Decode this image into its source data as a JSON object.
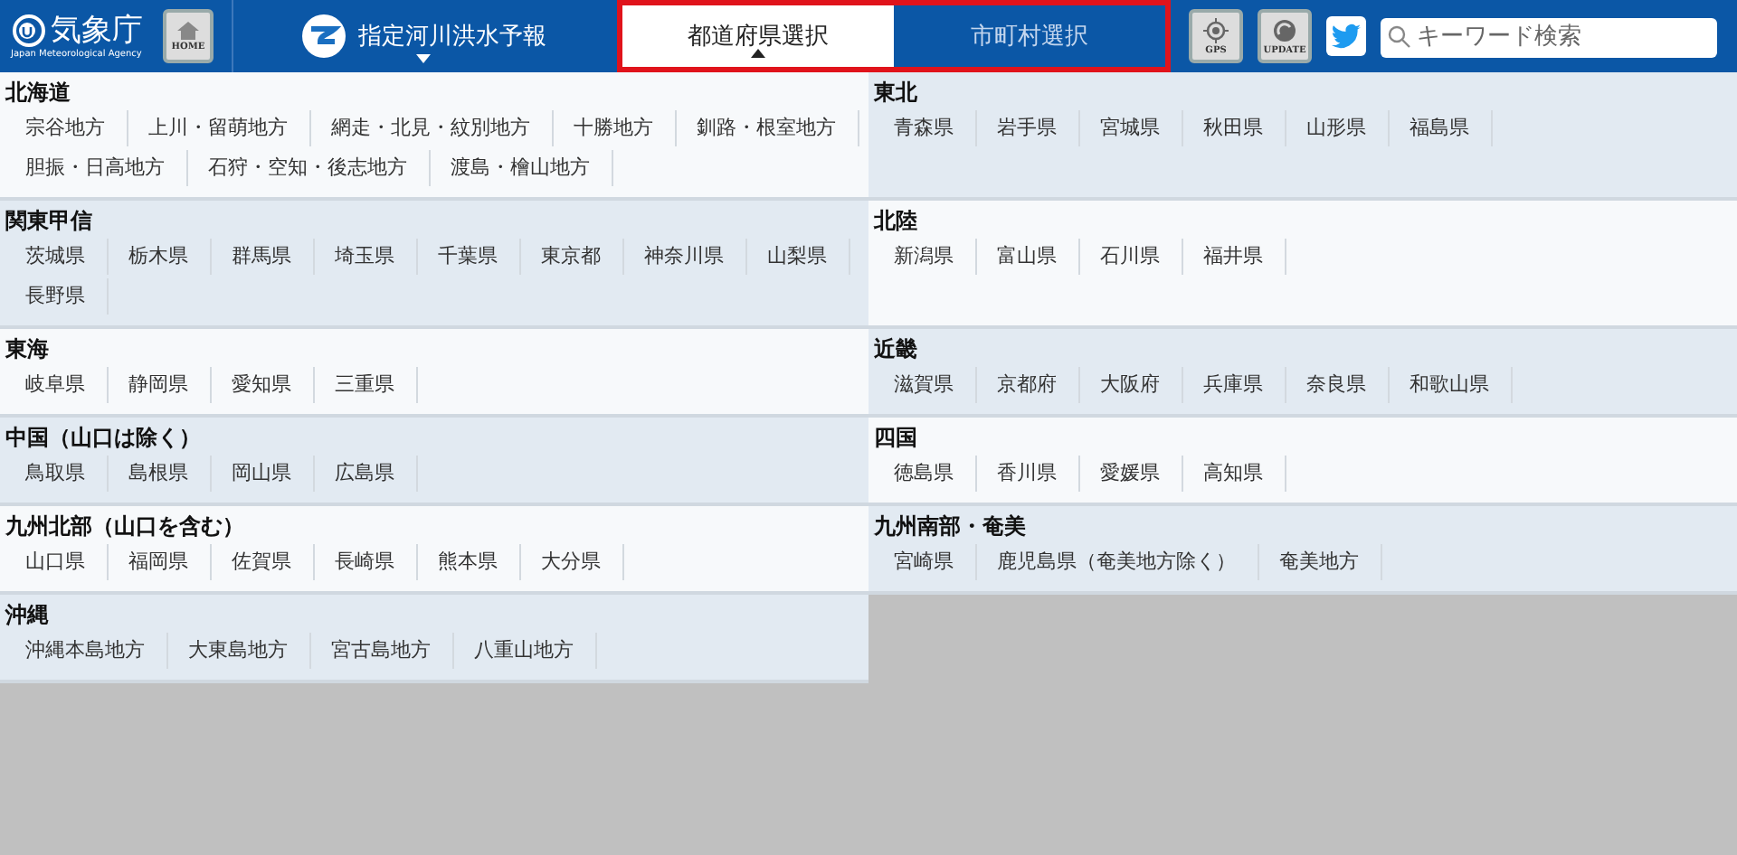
{
  "header": {
    "logo": {
      "name": "気象庁",
      "subtitle": "Japan Meteorological Agency"
    },
    "home_button": "HOME",
    "product_menu": {
      "label": "指定河川洪水予報"
    },
    "tabs": [
      {
        "label": "都道府県選択",
        "selected": true
      },
      {
        "label": "市町村選択",
        "selected": false
      }
    ],
    "gps_button": "GPS",
    "update_button": "UPDATE",
    "search": {
      "placeholder": "キーワード検索"
    }
  },
  "regions": [
    {
      "name": "北海道",
      "items": [
        "宗谷地方",
        "上川・留萌地方",
        "網走・北見・紋別地方",
        "十勝地方",
        "釧路・根室地方",
        "胆振・日高地方",
        "石狩・空知・後志地方",
        "渡島・檜山地方"
      ]
    },
    {
      "name": "東北",
      "items": [
        "青森県",
        "岩手県",
        "宮城県",
        "秋田県",
        "山形県",
        "福島県"
      ]
    },
    {
      "name": "関東甲信",
      "items": [
        "茨城県",
        "栃木県",
        "群馬県",
        "埼玉県",
        "千葉県",
        "東京都",
        "神奈川県",
        "山梨県",
        "長野県"
      ]
    },
    {
      "name": "北陸",
      "items": [
        "新潟県",
        "富山県",
        "石川県",
        "福井県"
      ]
    },
    {
      "name": "東海",
      "items": [
        "岐阜県",
        "静岡県",
        "愛知県",
        "三重県"
      ]
    },
    {
      "name": "近畿",
      "items": [
        "滋賀県",
        "京都府",
        "大阪府",
        "兵庫県",
        "奈良県",
        "和歌山県"
      ]
    },
    {
      "name": "中国（山口は除く）",
      "items": [
        "鳥取県",
        "島根県",
        "岡山県",
        "広島県"
      ]
    },
    {
      "name": "四国",
      "items": [
        "徳島県",
        "香川県",
        "愛媛県",
        "高知県"
      ]
    },
    {
      "name": "九州北部（山口を含む）",
      "items": [
        "山口県",
        "福岡県",
        "佐賀県",
        "長崎県",
        "熊本県",
        "大分県"
      ]
    },
    {
      "name": "九州南部・奄美",
      "items": [
        "宮崎県",
        "鹿児島県（奄美地方除く）",
        "奄美地方"
      ]
    },
    {
      "name": "沖縄",
      "items": [
        "沖縄本島地方",
        "大東島地方",
        "宮古島地方",
        "八重山地方"
      ]
    }
  ]
}
